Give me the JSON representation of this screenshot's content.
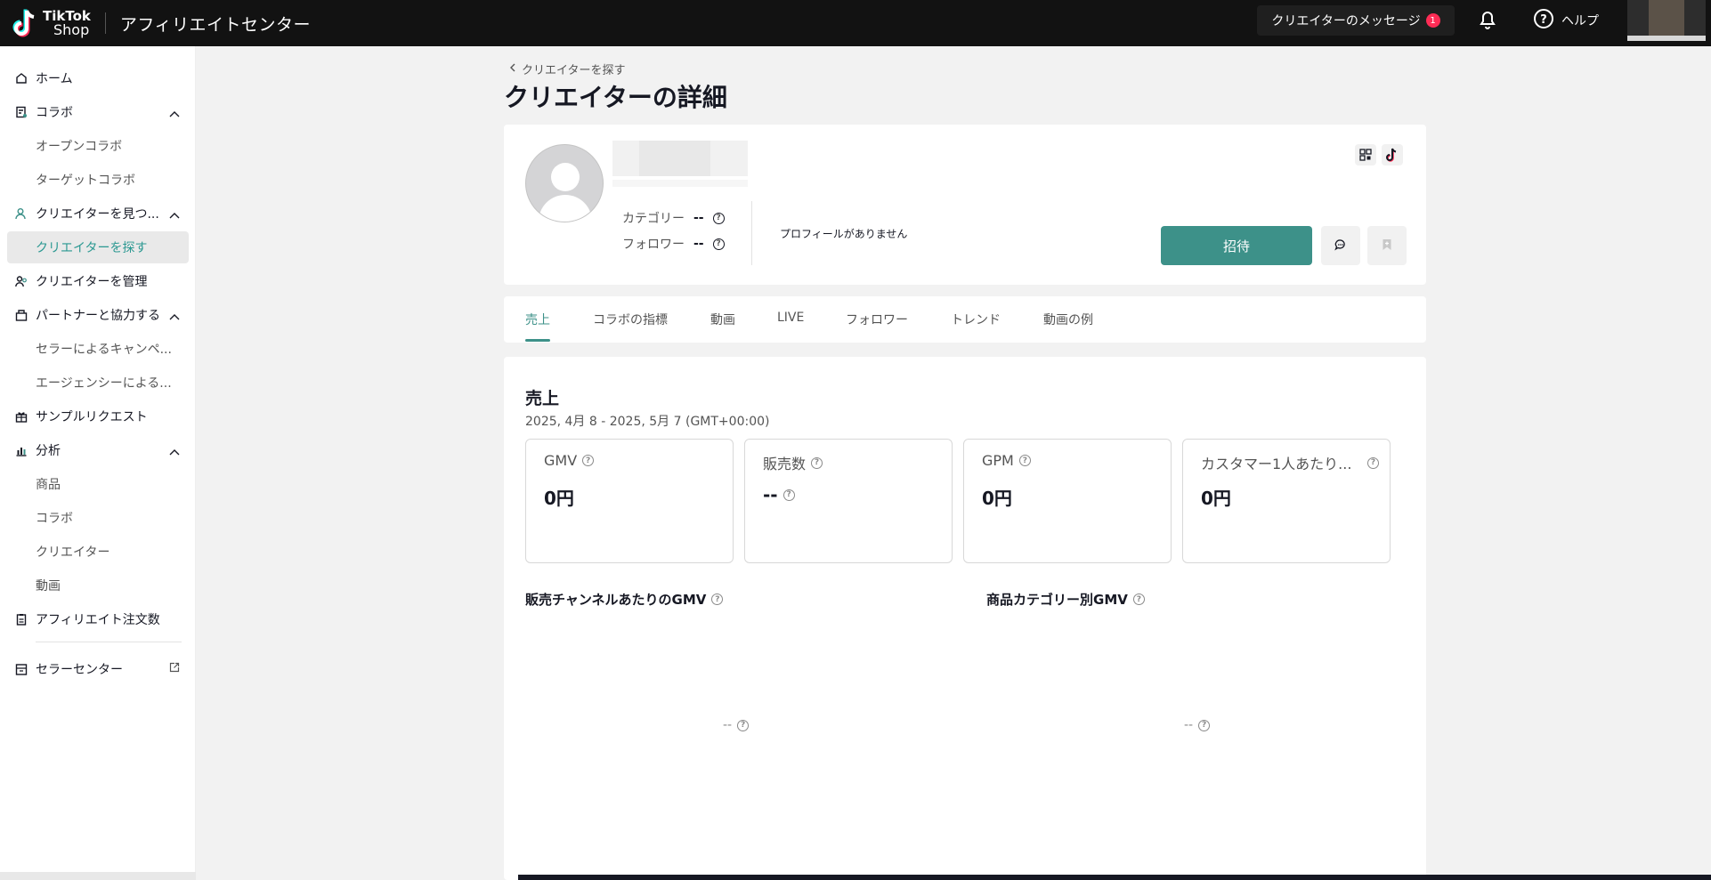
{
  "header": {
    "logo_line1": "TikTok",
    "logo_line2": "Shop",
    "app_title": "アフィリエイトセンター",
    "messages_label": "クリエイターのメッセージ",
    "messages_badge": "1",
    "help_label": "ヘルプ"
  },
  "sidebar": {
    "items": [
      {
        "label": "ホーム",
        "icon": "home-icon"
      },
      {
        "label": "コラボ",
        "icon": "collab-icon"
      },
      {
        "label": "オープンコラボ"
      },
      {
        "label": "ターゲットコラボ"
      },
      {
        "label": "クリエイターを見つ...",
        "icon": "find-creator-icon"
      },
      {
        "label": "クリエイターを探す"
      },
      {
        "label": "クリエイターを管理",
        "icon": "manage-creators-icon"
      },
      {
        "label": "パートナーと協力する",
        "icon": "partner-icon"
      },
      {
        "label": "セラーによるキャンペ..."
      },
      {
        "label": "エージェンシーによる..."
      },
      {
        "label": "サンプルリクエスト",
        "icon": "gift-icon"
      },
      {
        "label": "分析",
        "icon": "analytics-icon"
      },
      {
        "label": "商品"
      },
      {
        "label": "コラボ"
      },
      {
        "label": "クリエイター"
      },
      {
        "label": "動画"
      },
      {
        "label": "アフィリエイト注文数",
        "icon": "orders-icon"
      },
      {
        "label": "セラーセンター",
        "icon": "seller-center-icon"
      }
    ]
  },
  "breadcrumb": "クリエイターを探す",
  "page_title": "クリエイターの詳細",
  "profile": {
    "category_label": "カテゴリー",
    "category_value": "--",
    "followers_label": "フォロワー",
    "followers_value": "--",
    "bio": "プロフィールがありません",
    "invite_label": "招待"
  },
  "tabs": [
    "売上",
    "コラボの指標",
    "動画",
    "LIVE",
    "フォロワー",
    "トレンド",
    "動画の例"
  ],
  "sales": {
    "title": "売上",
    "date_range": "2025, 4月 8 - 2025, 5月 7 (GMT+00:00)",
    "metrics": [
      {
        "label": "GMV",
        "value": "0円"
      },
      {
        "label": "販売数",
        "value": "--"
      },
      {
        "label": "GPM",
        "value": "0円"
      },
      {
        "label": "カスタマー1人あたり...",
        "value": "0円"
      }
    ],
    "chart_channel_title": "販売チャンネルあたりのGMV",
    "chart_channel_value": "--",
    "chart_category_title": "商品カテゴリー別GMV",
    "chart_category_value": "--"
  },
  "colors": {
    "accent": "#3d9189",
    "header_bg": "#121212",
    "badge": "#fe2c55"
  }
}
